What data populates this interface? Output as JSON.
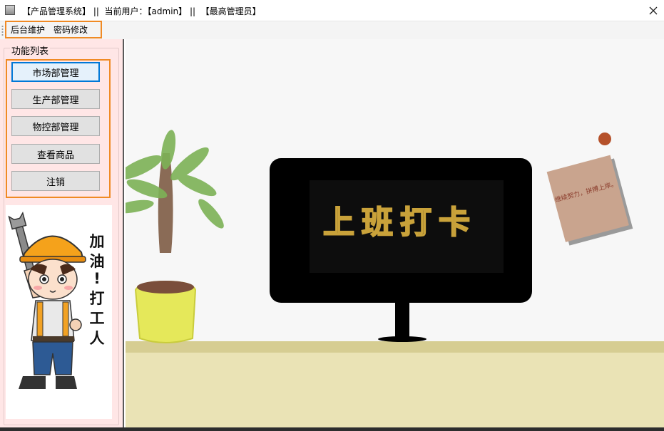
{
  "window": {
    "title": "【产品管理系统】 ||  当前用户：【admin】 ||  【最高管理员】",
    "icon": "app-window-icon",
    "close_glyph": "✕"
  },
  "menubar": {
    "items": [
      {
        "label": "后台维护"
      },
      {
        "label": "密码修改"
      }
    ]
  },
  "sidebar": {
    "group_title": "功能列表",
    "buttons": [
      {
        "label": "市场部管理",
        "active": true
      },
      {
        "label": "生产部管理"
      },
      {
        "label": "物控部管理"
      },
      {
        "label": "查看商品"
      },
      {
        "label": "注销"
      }
    ],
    "worker_illustration": {
      "text": "加油!打工人",
      "icon": "worker-cartoon"
    }
  },
  "scene": {
    "monitor_text": "上班打卡",
    "note_text": "继续努力，拼搏上岸。",
    "colors": {
      "monitor": "#000000",
      "monitor_text": "#c9a23a",
      "shelf": "#d6cd92",
      "pot": "#e5e85a",
      "note": "#c9a48e"
    }
  }
}
